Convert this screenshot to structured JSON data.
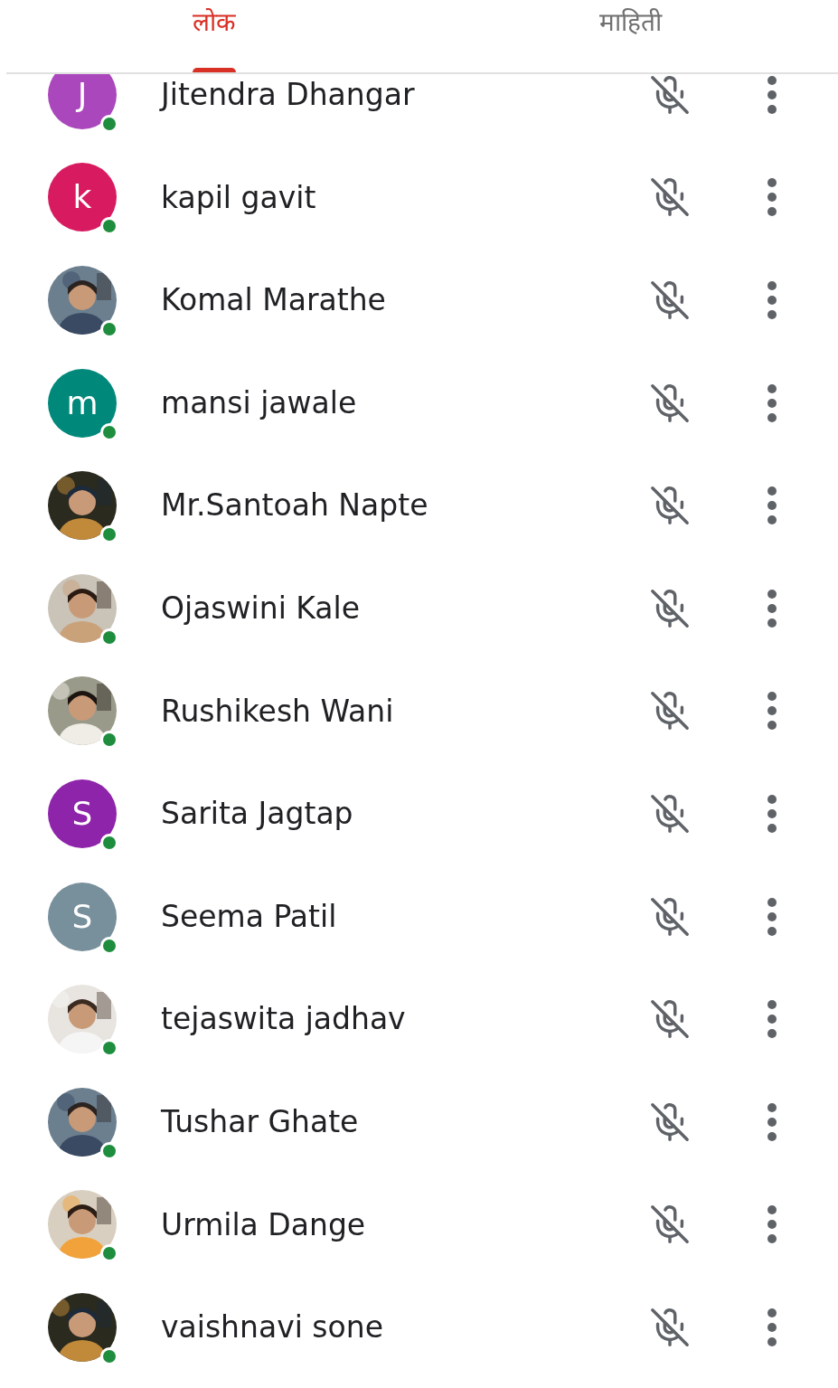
{
  "tabs": [
    {
      "label": "लोक",
      "selected": true
    },
    {
      "label": "माहिती",
      "selected": false
    }
  ],
  "participants": [
    {
      "name": "Jitendra Dhangar",
      "avatar": {
        "kind": "letter",
        "letter": "J",
        "color": "#ab47bc"
      },
      "online": true,
      "muted": true
    },
    {
      "name": "kapil gavit",
      "avatar": {
        "kind": "letter",
        "letter": "k",
        "color": "#d81b60"
      },
      "online": true,
      "muted": true
    },
    {
      "name": "Komal Marathe",
      "online": true,
      "muted": true
    },
    {
      "name": "mansi jawale",
      "avatar": {
        "kind": "letter",
        "letter": "m",
        "color": "#00897b"
      },
      "online": true,
      "muted": true
    },
    {
      "name": "Mr.Santoah Napte",
      "online": true,
      "muted": true
    },
    {
      "name": "Ojaswini Kale",
      "online": true,
      "muted": true
    },
    {
      "name": "Rushikesh Wani",
      "online": true,
      "muted": true
    },
    {
      "name": "Sarita Jagtap",
      "avatar": {
        "kind": "letter",
        "letter": "S",
        "color": "#8e24aa"
      },
      "online": true,
      "muted": true
    },
    {
      "name": "Seema Patil",
      "avatar": {
        "kind": "letter",
        "letter": "S",
        "color": "#78909c"
      },
      "online": true,
      "muted": true
    },
    {
      "name": "tejaswita jadhav",
      "online": true,
      "muted": true
    },
    {
      "name": "Tushar Ghate",
      "online": true,
      "muted": true
    },
    {
      "name": "Urmila Dange",
      "online": true,
      "muted": true
    },
    {
      "name": "vaishnavi sone",
      "online": true,
      "muted": true
    }
  ]
}
